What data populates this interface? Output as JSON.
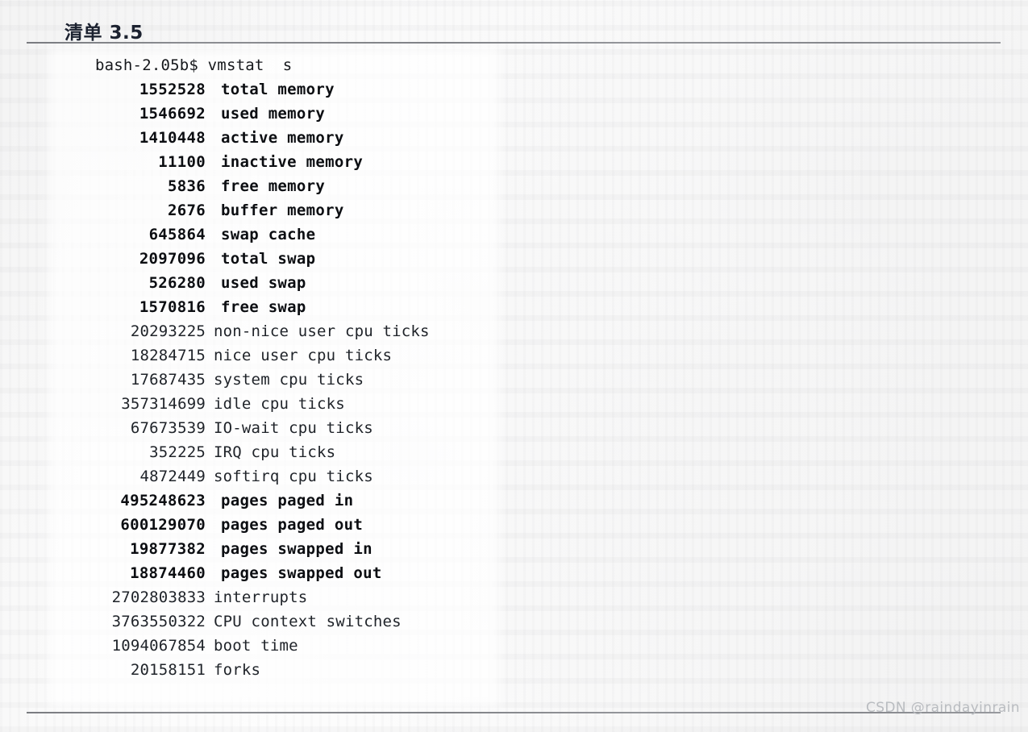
{
  "document": {
    "title": "清单 3.5",
    "watermark": "CSDN @raindayinrain",
    "colors": {
      "paper": "#fbfbfb",
      "ink": "#14161a",
      "title_ink": "#1c2230",
      "rule": "#7b7d82",
      "watermark": "#b9bcc0"
    }
  },
  "terminal": {
    "prompt_line": "bash-2.05b$ vmstat  s",
    "rows": [
      {
        "value": "1552528",
        "label": "total memory",
        "emphasis": true
      },
      {
        "value": "1546692",
        "label": "used memory",
        "emphasis": true
      },
      {
        "value": "1410448",
        "label": "active memory",
        "emphasis": true
      },
      {
        "value": "11100",
        "label": "inactive memory",
        "emphasis": true
      },
      {
        "value": "5836",
        "label": "free memory",
        "emphasis": true
      },
      {
        "value": "2676",
        "label": "buffer memory",
        "emphasis": true
      },
      {
        "value": "645864",
        "label": "swap cache",
        "emphasis": true
      },
      {
        "value": "2097096",
        "label": "total swap",
        "emphasis": true
      },
      {
        "value": "526280",
        "label": "used swap",
        "emphasis": true
      },
      {
        "value": "1570816",
        "label": "free swap",
        "emphasis": true
      },
      {
        "value": "20293225",
        "label": "non-nice user cpu ticks",
        "emphasis": false
      },
      {
        "value": "18284715",
        "label": "nice user cpu ticks",
        "emphasis": false
      },
      {
        "value": "17687435",
        "label": "system cpu ticks",
        "emphasis": false
      },
      {
        "value": "357314699",
        "label": "idle cpu ticks",
        "emphasis": false
      },
      {
        "value": "67673539",
        "label": "IO-wait cpu ticks",
        "emphasis": false
      },
      {
        "value": "352225",
        "label": "IRQ cpu ticks",
        "emphasis": false
      },
      {
        "value": "4872449",
        "label": "softirq cpu ticks",
        "emphasis": false
      },
      {
        "value": "495248623",
        "label": "pages paged in",
        "emphasis": true
      },
      {
        "value": "600129070",
        "label": "pages paged out",
        "emphasis": true
      },
      {
        "value": "19877382",
        "label": "pages swapped in",
        "emphasis": true
      },
      {
        "value": "18874460",
        "label": "pages swapped out",
        "emphasis": true
      },
      {
        "value": "2702803833",
        "label": "interrupts",
        "emphasis": false
      },
      {
        "value": "3763550322",
        "label": "CPU context switches",
        "emphasis": false
      },
      {
        "value": "1094067854",
        "label": "boot time",
        "emphasis": false
      },
      {
        "value": "20158151",
        "label": "forks",
        "emphasis": false
      }
    ]
  }
}
